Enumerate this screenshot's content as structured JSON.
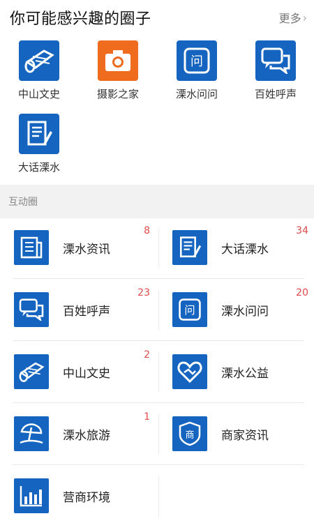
{
  "header": {
    "title": "你可能感兴趣的圈子",
    "more_label": "更多"
  },
  "circles": [
    {
      "label": "中山文史",
      "icon": "scroll-icon",
      "color": "#1565c0"
    },
    {
      "label": "摄影之家",
      "icon": "camera-icon",
      "color": "#ef6c1f"
    },
    {
      "label": "溧水问问",
      "icon": "question-icon",
      "color": "#1565c0"
    },
    {
      "label": "百姓呼声",
      "icon": "chat-bubbles-icon",
      "color": "#1565c0"
    },
    {
      "label": "大话溧水",
      "icon": "document-pen-icon",
      "color": "#1565c0"
    }
  ],
  "section": {
    "title": "互动圈"
  },
  "interactive": [
    {
      "name": "溧水资讯",
      "badge": "8",
      "icon": "newspaper-icon"
    },
    {
      "name": "大话溧水",
      "badge": "34",
      "icon": "document-pen-icon"
    },
    {
      "name": "百姓呼声",
      "badge": "23",
      "icon": "chat-bubbles-icon"
    },
    {
      "name": "溧水问问",
      "badge": "20",
      "icon": "question-icon"
    },
    {
      "name": "中山文史",
      "badge": "2",
      "icon": "scroll-icon"
    },
    {
      "name": "溧水公益",
      "badge": "",
      "icon": "heart-hands-icon"
    },
    {
      "name": "溧水旅游",
      "badge": "1",
      "icon": "beach-umbrella-icon"
    },
    {
      "name": "商家资讯",
      "badge": "",
      "icon": "shop-shield-icon"
    },
    {
      "name": "营商环境",
      "badge": "",
      "icon": "bar-chart-icon"
    }
  ],
  "icon_glyphs": {
    "question": "问",
    "shop": "商"
  },
  "colors": {
    "brand_blue": "#1565c0",
    "orange": "#ef6c1f",
    "badge_red": "#e04a4a"
  }
}
